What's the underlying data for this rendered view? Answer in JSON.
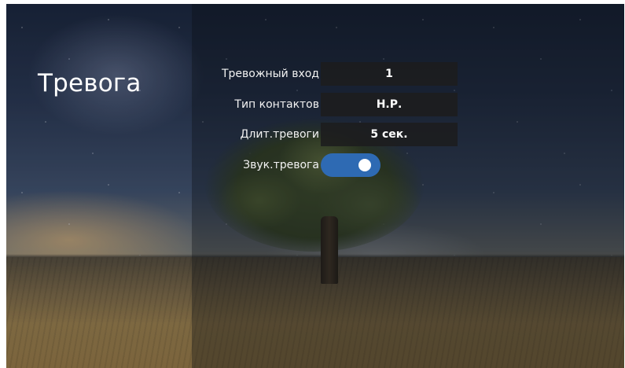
{
  "page": {
    "title": "Тревога"
  },
  "settings": [
    {
      "label": "Тревожный вход",
      "value": "1",
      "type": "value"
    },
    {
      "label": "Тип контактов",
      "value": "Н.Р.",
      "type": "value"
    },
    {
      "label": "Длит.тревоги",
      "value": "5 сек.",
      "type": "value"
    },
    {
      "label": "Звук.тревога",
      "value": "on",
      "type": "toggle"
    }
  ],
  "colors": {
    "toggle_on": "#2e6ab3",
    "value_box": "#1c1c1e",
    "text": "#ffffff"
  },
  "icons": {
    "background_image": "night-sky-tree-field"
  }
}
